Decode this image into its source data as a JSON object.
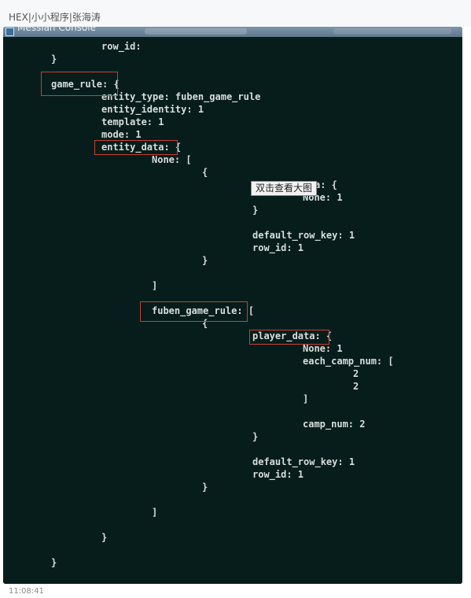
{
  "post": {
    "title": "HEX|小小程序|张海涛",
    "timestamp": "11:08:41"
  },
  "window": {
    "title": "Messiah Console"
  },
  "tooltip": {
    "text": "双击查看大图"
  },
  "console": {
    "lines": [
      "row_id:",
      "}",
      "game_rule: {",
      "entity_type: fuben_game_rule",
      "entity_identity: 1",
      "template: 1",
      "mode: 1",
      "entity_data: {",
      "None: [",
      "{",
      "a: {",
      "None: 1",
      "}",
      "default_row_key: 1",
      "row_id: 1",
      "}",
      "]",
      "fuben_game_rule: [",
      "{",
      "player_data: {",
      "None: 1",
      "each_camp_num: [",
      "2",
      "2",
      "]",
      "camp_num: 2",
      "}",
      "default_row_key: 1",
      "row_id: 1",
      "}",
      "]",
      "}",
      "}"
    ]
  },
  "colors": {
    "console_bg": "#071d1b",
    "console_text": "#d6dedd",
    "highlight_border": "#c8402e"
  }
}
